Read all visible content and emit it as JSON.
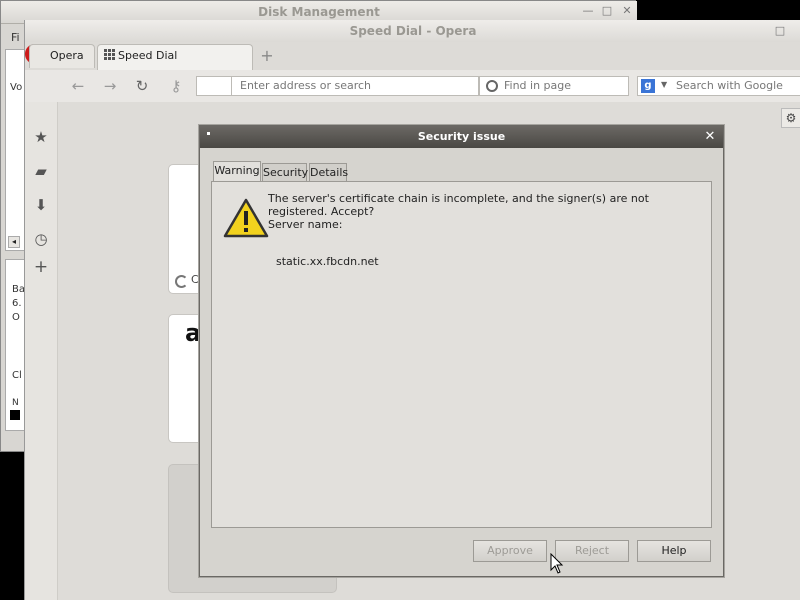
{
  "disk_management": {
    "title": "Disk Management",
    "menu_first": "Fi",
    "side_labels": [
      "Vo",
      "Ba",
      "6.",
      "O",
      "Cl",
      "N"
    ]
  },
  "opera": {
    "title": "Speed Dial - Opera",
    "tabs": [
      {
        "label": "Opera"
      },
      {
        "label": "Speed Dial"
      }
    ],
    "address_placeholder": "Enter address or search",
    "find_placeholder": "Find in page",
    "search_placeholder": "Search with Google",
    "tile_text_1": "C",
    "tile_text_2": "a"
  },
  "dialog": {
    "title": "Security issue",
    "tabs": [
      "Warning",
      "Security",
      "Details"
    ],
    "message": "The server's certificate chain is incomplete, and the signer(s) are not registered. Accept?",
    "server_label": "Server name:",
    "server_name": "static.xx.fbcdn.net",
    "buttons": {
      "approve": "Approve",
      "reject": "Reject",
      "help": "Help"
    }
  },
  "icons": {
    "warning": "warning-triangle-icon",
    "close": "close-icon"
  },
  "colors": {
    "title_bar": "#4a4844",
    "warning_yellow": "#f2d21e",
    "opera_red": "#cc1b1b"
  }
}
